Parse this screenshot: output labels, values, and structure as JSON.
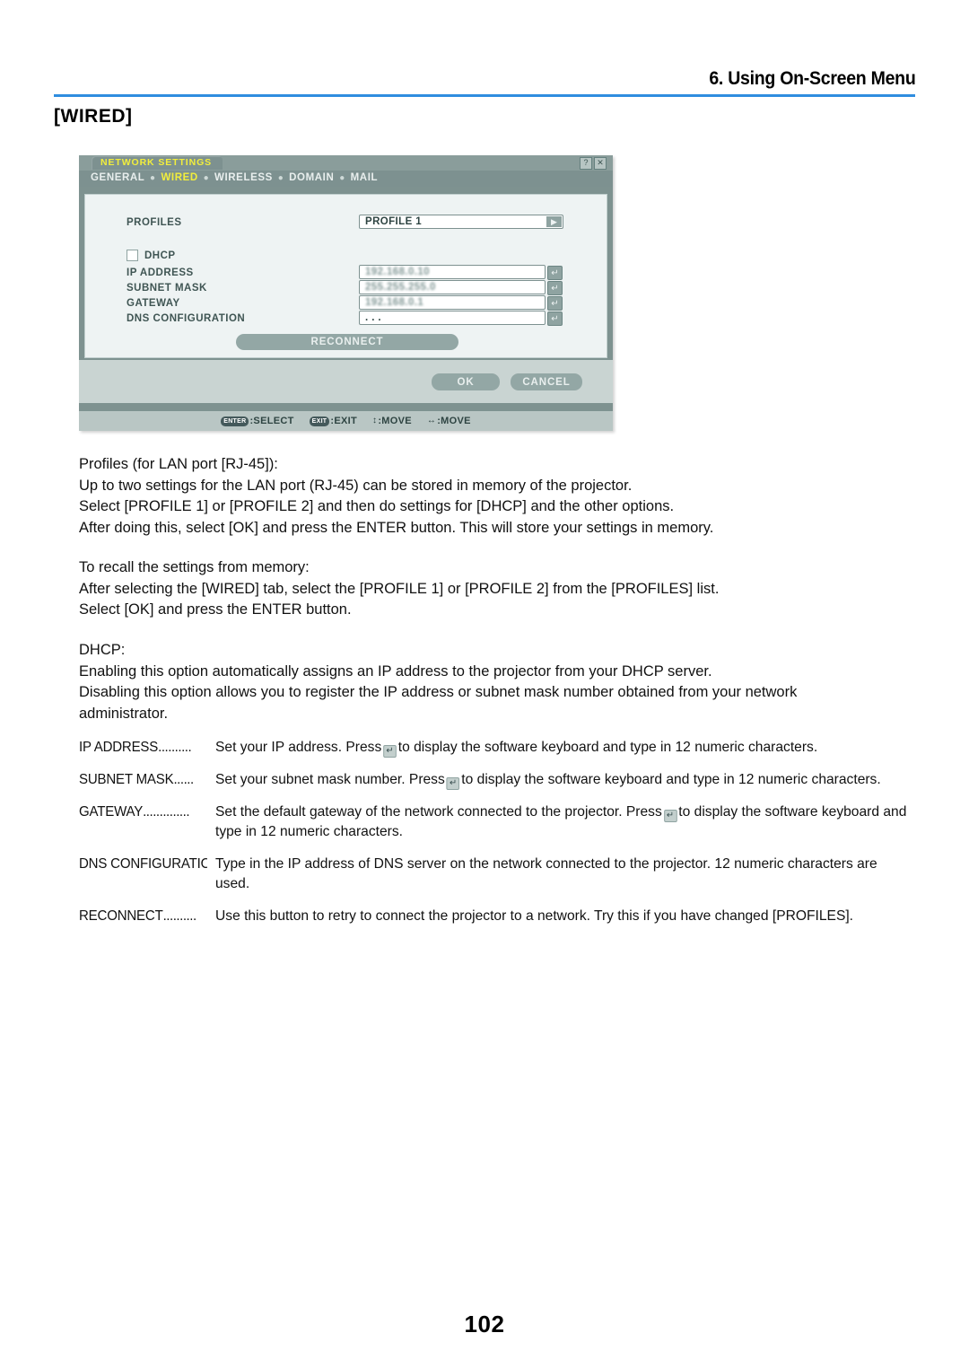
{
  "header": {
    "chapter_title": "6. Using On-Screen Menu",
    "rule_color": "#2f8ddf"
  },
  "section": {
    "heading": "[WIRED]"
  },
  "osd": {
    "window_title": "NETWORK SETTINGS",
    "help_button": "?",
    "close_button": "✕",
    "tabs": [
      {
        "label": "GENERAL",
        "active": false
      },
      {
        "label": "WIRED",
        "active": true
      },
      {
        "label": "WIRELESS",
        "active": false
      },
      {
        "label": "DOMAIN",
        "active": false
      },
      {
        "label": "MAIL",
        "active": false
      }
    ],
    "tab_separator": "●",
    "active_tab_color": "#f2ee3c",
    "title_color": "#f2ee3c",
    "header_color": "#7d9190",
    "body_color": "#eef3f3",
    "fields": {
      "profiles_label": "PROFILES",
      "profiles_value": "PROFILE 1",
      "profiles_arrow": "▶",
      "dhcp_label": "DHCP",
      "dhcp_checked": false,
      "ip_address_label": "IP ADDRESS",
      "ip_address_value": "192.168.0.10",
      "subnet_mask_label": "SUBNET MASK",
      "subnet_mask_value": "255.255.255.0",
      "gateway_label": "GATEWAY",
      "gateway_value": "192.168.0.1",
      "dns_label": "DNS CONFIGURATION",
      "dns_value": ". . .",
      "enter_glyph": "↵"
    },
    "reconnect_button": "RECONNECT",
    "ok_button": "OK",
    "cancel_button": "CANCEL",
    "status": [
      {
        "key": "ENTER",
        "key_type": "cap",
        "text": ":SELECT"
      },
      {
        "key": "EXIT",
        "key_type": "cap",
        "text": ":EXIT"
      },
      {
        "key": "↕",
        "key_type": "glyph",
        "text": ":MOVE"
      },
      {
        "key": "↔",
        "key_type": "glyph",
        "text": ":MOVE"
      }
    ]
  },
  "body": {
    "para1": [
      "Profiles (for LAN port [RJ-45]):",
      "Up to two settings for the LAN port (RJ-45) can be stored in memory of the projector.",
      "Select [PROFILE 1] or [PROFILE 2] and then do settings for [DHCP] and the other options.",
      "After doing this, select [OK] and press the ENTER button. This will store your settings in memory."
    ],
    "para2": [
      "To recall the settings from memory:",
      "After selecting the [WIRED] tab, select the [PROFILE 1] or [PROFILE 2] from the [PROFILES] list.",
      "Select [OK] and press the ENTER button."
    ],
    "para3": [
      "DHCP:",
      "Enabling this option automatically assigns an IP address to the projector from your DHCP server.",
      "Disabling this option allows you to register the IP address or subnet mask number obtained from your network",
      "administrator."
    ]
  },
  "definitions": [
    {
      "term": "IP ADDRESS",
      "dots": "..........",
      "desc_before": "Set your IP address. Press",
      "has_icon": true,
      "desc_after": "to display the software keyboard and type in 12 numeric characters."
    },
    {
      "term": "SUBNET MASK",
      "dots": "......",
      "desc_before": "Set your subnet mask number. Press",
      "has_icon": true,
      "desc_after": "to display the software keyboard and type in 12 numeric characters."
    },
    {
      "term": "GATEWAY",
      "dots": "..............",
      "desc_before": "Set the default gateway of the network connected to the projector. Press",
      "has_icon": true,
      "desc_after": "to display the software keyboard and type in 12 numeric characters."
    },
    {
      "term": "DNS CONFIGURATION",
      "dots": "..",
      "desc_before": "Type in the IP address of DNS server on the network connected to the projector. 12 numeric characters are used.",
      "has_icon": false,
      "desc_after": ""
    },
    {
      "term": "RECONNECT",
      "dots": "..........",
      "desc_before": "Use this button to retry to connect the projector to a network. Try this if you have changed [PROFILES].",
      "has_icon": false,
      "desc_after": ""
    }
  ],
  "footer": {
    "page_number": "102"
  }
}
